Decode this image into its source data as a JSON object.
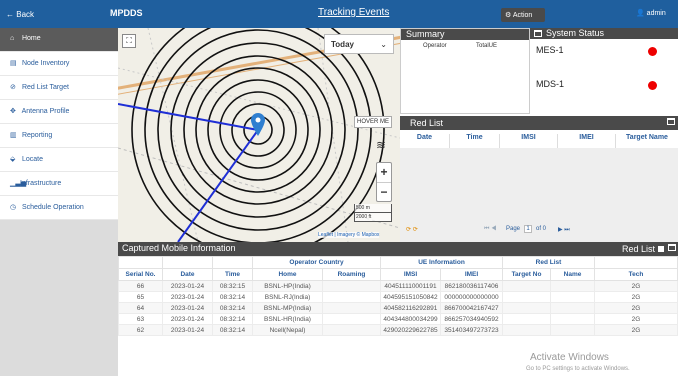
{
  "topbar": {
    "back_label": "Back",
    "back_icon": "arrow-left-icon",
    "app_name": "MPDDS",
    "page_title": "Tracking Events",
    "action_label": "Action",
    "user_label": "admin"
  },
  "sidebar": {
    "items": [
      {
        "label": "Home",
        "icon": "home-icon"
      },
      {
        "label": "Node Inventory",
        "icon": "server-icon"
      },
      {
        "label": "Red List Target",
        "icon": "ban-icon"
      },
      {
        "label": "Antenna Profile",
        "icon": "antenna-icon"
      },
      {
        "label": "Reporting",
        "icon": "chart-icon"
      },
      {
        "label": "Locate",
        "icon": "map-marker-icon"
      },
      {
        "label": "Infrastructure",
        "icon": "signal-icon"
      },
      {
        "label": "Schedule Operation",
        "icon": "clock-icon"
      }
    ]
  },
  "map": {
    "range_select": "Today",
    "hover_label": "HOVER ME",
    "scale_top": "500 m",
    "scale_bottom": "2000 ft",
    "attribution": "Leaflet | Imagery © Mapbox"
  },
  "summary": {
    "title": "Summary",
    "columns": [
      "Operator",
      "TotalUE"
    ]
  },
  "system_status": {
    "title": "System Status",
    "items": [
      {
        "name": "MES-1",
        "status_color": "#e00000"
      },
      {
        "name": "MDS-1",
        "status_color": "#e00000"
      }
    ]
  },
  "red_list": {
    "title": "Red List",
    "columns": [
      "Date",
      "Time",
      "IMSI",
      "IMEI",
      "Target Name"
    ],
    "pager": {
      "page_label": "Page",
      "page": "1",
      "of_label": "of 0"
    }
  },
  "captured": {
    "title": "Captured Mobile Information",
    "red_list_label": "Red List",
    "group_headers": {
      "operator_country": "Operator Country",
      "ue_info": "UE Information",
      "red_list": "Red List"
    },
    "columns": [
      "Serial No.",
      "Date",
      "Time",
      "Home",
      "Roaming",
      "IMSI",
      "IMEI",
      "Target No",
      "Name",
      "Tech"
    ],
    "rows": [
      {
        "serial": "66",
        "date": "2023-01-24",
        "time": "08:32:15",
        "home": "BSNL-HP(India)",
        "roaming": "",
        "imsi": "404511110001191",
        "imei": "862180036117406",
        "target_no": "",
        "name": "",
        "tech": "2G"
      },
      {
        "serial": "65",
        "date": "2023-01-24",
        "time": "08:32:14",
        "home": "BSNL-RJ(India)",
        "roaming": "",
        "imsi": "404595151050842",
        "imei": "000000000000000",
        "target_no": "",
        "name": "",
        "tech": "2G"
      },
      {
        "serial": "64",
        "date": "2023-01-24",
        "time": "08:32:14",
        "home": "BSNL-MP(India)",
        "roaming": "",
        "imsi": "404582116292891",
        "imei": "866700042167427",
        "target_no": "",
        "name": "",
        "tech": "2G"
      },
      {
        "serial": "63",
        "date": "2023-01-24",
        "time": "08:32:14",
        "home": "BSNL-HR(India)",
        "roaming": "",
        "imsi": "404344800034299",
        "imei": "866257034940592",
        "target_no": "",
        "name": "",
        "tech": "2G"
      },
      {
        "serial": "62",
        "date": "2023-01-24",
        "time": "08:32:14",
        "home": "Ncell(Nepal)",
        "roaming": "",
        "imsi": "429020229622785",
        "imei": "351403497273723",
        "target_no": "",
        "name": "",
        "tech": "2G"
      }
    ]
  },
  "watermark": {
    "line1": "Activate Windows",
    "line2": "Go to PC settings to activate Windows."
  },
  "colors": {
    "topbar": "#1f5f9e",
    "panel_header": "#4a4a4a",
    "link": "#2a5d9c",
    "status_down": "#e00000"
  }
}
